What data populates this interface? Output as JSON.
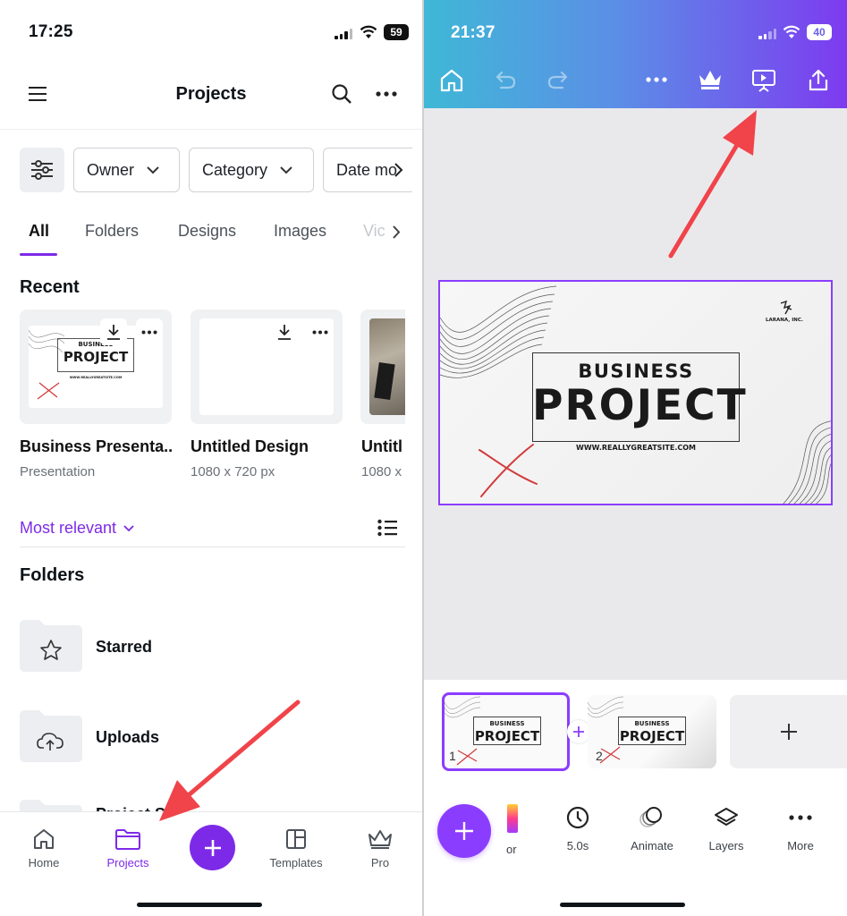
{
  "left": {
    "status": {
      "time": "17:25",
      "battery": "59"
    },
    "header": {
      "title": "Projects"
    },
    "filters": [
      "Owner",
      "Category",
      "Date mo"
    ],
    "tabs": [
      "All",
      "Folders",
      "Designs",
      "Images",
      "Vic"
    ],
    "recent_heading": "Recent",
    "thumb_text": {
      "line1": "BUSINESS",
      "line2": "PROJECT",
      "line3": "WWW.REALLYGREATSITE.COM"
    },
    "recent": [
      {
        "title": "Business Presenta...",
        "sub": "Presentation"
      },
      {
        "title": "Untitled Design",
        "sub": "1080 x 720 px"
      },
      {
        "title": "Untitl",
        "sub": "1080 x"
      }
    ],
    "sort_label": "Most relevant",
    "folders_heading": "Folders",
    "folders": [
      "Starred",
      "Uploads",
      "Project Sh"
    ],
    "nav": [
      "Home",
      "Projects",
      "Templates",
      "Pro"
    ]
  },
  "right": {
    "status": {
      "time": "21:37",
      "battery": "40"
    },
    "slide": {
      "line1": "BUSINESS",
      "line2": "PROJECT",
      "line3": "WWW.REALLYGREATSITE.COM",
      "brand": "LARANA, INC."
    },
    "pages": [
      "1",
      "2"
    ],
    "tools": [
      "or",
      "5.0s",
      "Animate",
      "Layers",
      "More"
    ]
  },
  "colors": {
    "accent": "#7d2ae8",
    "arrow": "#f0434a",
    "gradient_start": "#3fb8d6",
    "gradient_end": "#7d3bf0"
  }
}
